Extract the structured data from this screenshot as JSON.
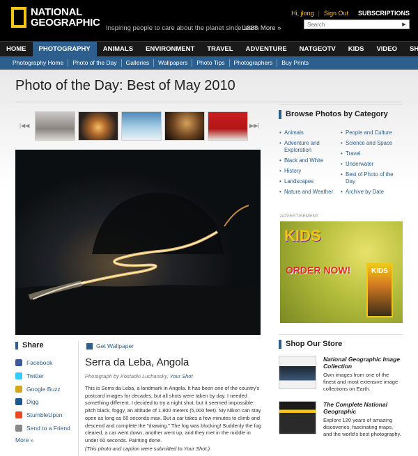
{
  "header": {
    "logo_line1": "NATIONAL",
    "logo_line2": "GEOGRAPHIC",
    "tagline": "Inspiring people to care about the planet since 1888",
    "learn_more": "Learn More »",
    "greeting": "Hi, jlong",
    "sign_out": "Sign Out",
    "subscriptions": "SUBSCRIPTIONS",
    "search_placeholder": "Search",
    "search_go": "▶",
    "colors": {
      "brand_yellow": "#f3c615",
      "nav_blue": "#2d5f8e"
    }
  },
  "nav": {
    "items": [
      "HOME",
      "PHOTOGRAPHY",
      "ANIMALS",
      "ENVIRONMENT",
      "TRAVEL",
      "ADVENTURE",
      "NATGEOTV",
      "KIDS",
      "VIDEO",
      "SHOP"
    ],
    "active": "PHOTOGRAPHY"
  },
  "subnav": {
    "items": [
      "Photography Home",
      "Photo of the Day",
      "Galleries",
      "Wallpapers",
      "Photo Tips",
      "Photographers",
      "Buy Prints"
    ]
  },
  "page": {
    "title": "Photo of the Day: Best of May 2010",
    "prev_icon": "|◀◀",
    "next_icon": "▶▶|"
  },
  "share": {
    "title": "Share",
    "items": [
      {
        "label": "Facebook",
        "icon": "facebook-icon",
        "color": "#3b5998"
      },
      {
        "label": "Twitter",
        "icon": "twitter-icon",
        "color": "#33ccff"
      },
      {
        "label": "Google Buzz",
        "icon": "google-buzz-icon",
        "color": "#d9a521"
      },
      {
        "label": "Digg",
        "icon": "digg-icon",
        "color": "#1b5790"
      },
      {
        "label": "StumbleUpon",
        "icon": "stumbleupon-icon",
        "color": "#eb4924"
      },
      {
        "label": "Send to a Friend",
        "icon": "email-icon",
        "color": "#888888"
      }
    ],
    "more": "More »"
  },
  "photo": {
    "get_wallpaper": "Get Wallpaper",
    "title": "Serra da Leba, Angola",
    "credit_prefix": "Photograph by Kostadin Luchansky,",
    "credit_source": "Your Shot",
    "caption": "This is Serra da Leba, a landmark in Angola. It has been one of the country's postcard images for decades, but all shots were taken by day. I needed something different. I decided to try a night shot, but it seemed impossible: pitch black, foggy, an altitude of 1,800 meters (5,000 feet). My Nikon can stay open as long as 60 seconds max. But a car takes a few minutes to climb and descend and complete the \"drawing.\" The fog was blocking! Suddenly the fog cleared, a car went down, another went up, and they met in the middle in under 60 seconds. Painting done.",
    "note": "(This photo and caption were submitted to Your Shot.)"
  },
  "browse": {
    "title": "Browse Photos by Category",
    "col1": [
      "Animals",
      "Adventure and Exploration",
      "Black and White",
      "History",
      "Landscapes",
      "Nature and Weather"
    ],
    "col2": [
      "People and Culture",
      "Science and Space",
      "Travel",
      "Underwater",
      "Best of Photo of the Day",
      "Archive by Date"
    ]
  },
  "ad": {
    "label": "ADVERTISEMENT",
    "brand": "KIDS",
    "cta": "ORDER NOW!",
    "mag_title": "KIDS"
  },
  "shop": {
    "title": "Shop Our Store",
    "items": [
      {
        "name": "National Geographic Image Collection",
        "desc": "Own images from one of the finest and most extensive image collections on Earth."
      },
      {
        "name": "The Complete National Geographic",
        "desc": "Explore 120 years of amazing discoveries, fascinating maps, and the world's best photography."
      }
    ]
  }
}
